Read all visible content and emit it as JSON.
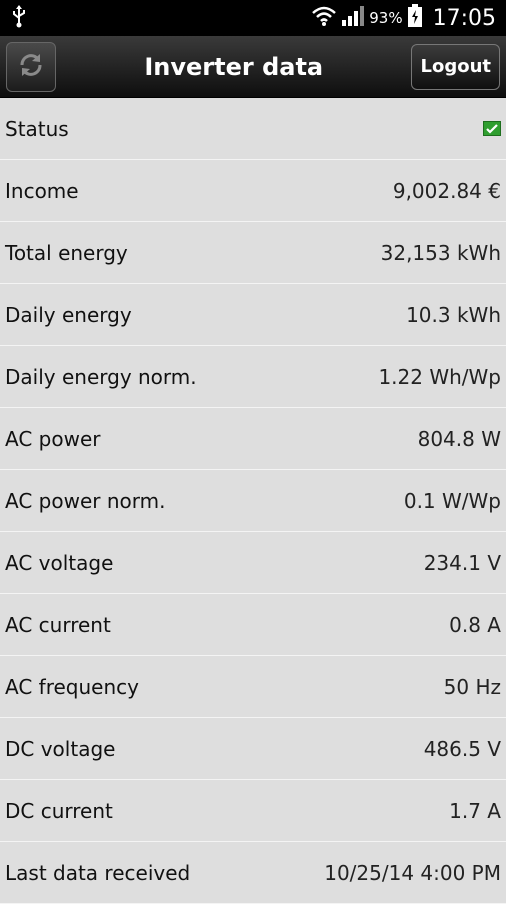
{
  "statusbar": {
    "usb_icon": "usb-icon",
    "wifi_icon": "wifi-icon",
    "signal_icon": "signal-icon",
    "battery_percent": "93%",
    "battery_icon": "battery-charging-icon",
    "time": "17:05"
  },
  "actionbar": {
    "title": "Inverter data",
    "refresh_icon": "refresh-icon",
    "logout_label": "Logout"
  },
  "rows": [
    {
      "label": "Status",
      "value": ""
    },
    {
      "label": "Income",
      "value": "9,002.84 €"
    },
    {
      "label": "Total energy",
      "value": "32,153 kWh"
    },
    {
      "label": "Daily energy",
      "value": "10.3 kWh"
    },
    {
      "label": "Daily energy norm.",
      "value": "1.22 Wh/Wp"
    },
    {
      "label": "AC power",
      "value": "804.8 W"
    },
    {
      "label": "AC power norm.",
      "value": "0.1 W/Wp"
    },
    {
      "label": "AC voltage",
      "value": "234.1 V"
    },
    {
      "label": "AC current",
      "value": "0.8 A"
    },
    {
      "label": "AC frequency",
      "value": "50 Hz"
    },
    {
      "label": "DC voltage",
      "value": "486.5 V"
    },
    {
      "label": "DC current",
      "value": "1.7 A"
    },
    {
      "label": "Last data received",
      "value": "10/25/14 4:00 PM"
    }
  ],
  "colors": {
    "status_ok": "#2f9e2f",
    "background": "#dcdcdc",
    "actionbar": "#1a1a1a"
  }
}
